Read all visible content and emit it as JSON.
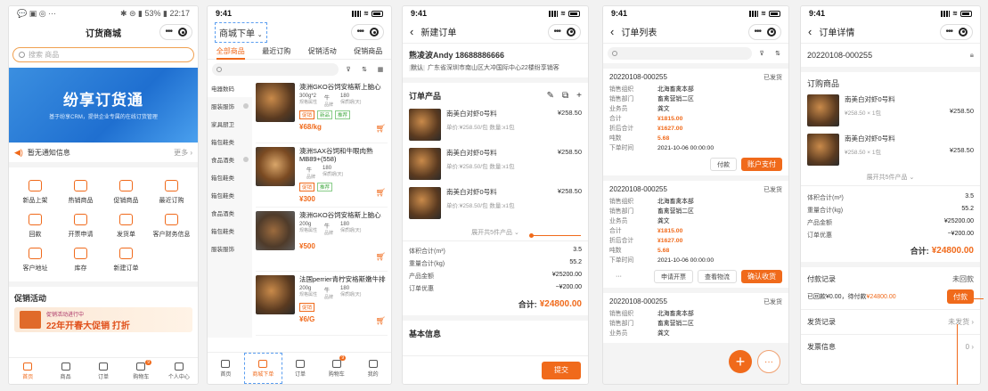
{
  "p1": {
    "status_left": "💬 ▣ ◎ ···",
    "status_right": "✱ ⊜ ▮ 53% ▮ 22:17",
    "title": "订货商城",
    "search_placeholder": "搜索 商品",
    "banner_title": "纷享订货通",
    "banner_sub": "基于纷享CRM，提供企业专属的在线订货管理",
    "notice_label": "暂无通知信息",
    "notice_more": "更多",
    "menu": [
      "新品上架",
      "热销商品",
      "促销商品",
      "最近订购",
      "回款",
      "开票申请",
      "发货单",
      "客户财务信息",
      "客户地址",
      "库存",
      "新建订单"
    ],
    "promo_title": "促销活动",
    "promo_line": "促销活动进行中",
    "promo_big": "22年开春大促销 打折",
    "tabs": [
      "首页",
      "商品",
      "订单",
      "购物车",
      "个人中心"
    ],
    "cart_badge": "9"
  },
  "p2": {
    "time": "9:41",
    "title": "商城下单",
    "tabs": [
      "全部商品",
      "最近订购",
      "促销活动",
      "促销商品"
    ],
    "cats": [
      "电器数码",
      "服装服饰",
      "家具厨卫",
      "箱包鞋类",
      "食品酒类",
      "箱包鞋类",
      "箱包鞋类",
      "食品酒类",
      "箱包鞋类",
      "服装服饰"
    ],
    "items": [
      {
        "name": "澳洲GKO谷饲安格斯上脑心",
        "spec": "300g*2",
        "unit_label": "规格属性",
        "v2": "牛",
        "v2l": "品牌",
        "v3": "180",
        "v3l": "保质期(天)",
        "tags": [
          "促销",
          "新品",
          "推荐"
        ],
        "price": "¥68/kg"
      },
      {
        "name": "澳洲SAX谷饲和牛眼肉熟MB89+(558)",
        "spec": "",
        "unit_label": "",
        "v2": "牛",
        "v2l": "品牌",
        "v3": "180",
        "v3l": "保质期(天)",
        "tags": [
          "促销",
          "推荐"
        ],
        "price": "¥300"
      },
      {
        "name": "澳洲GKO谷饲安格斯上脑心",
        "spec": "200g",
        "unit_label": "规格属性",
        "v2": "牛",
        "v2l": "品牌",
        "v3": "180",
        "v3l": "保质期(天)",
        "tags": [],
        "price": "¥500"
      },
      {
        "name": "法国perrier青柠安格斯嫩牛排",
        "spec": "200g",
        "unit_label": "规格属性",
        "v2": "牛",
        "v2l": "品牌",
        "v3": "180",
        "v3l": "保质期(天)",
        "tags": [
          "促销"
        ],
        "price": "¥6/G"
      }
    ],
    "tabs_bottom": [
      "首页",
      "商城下单",
      "订单",
      "购物车",
      "我的"
    ],
    "cart_badge": "9"
  },
  "p3": {
    "time": "9:41",
    "title": "新建订单",
    "contact": "熊凌波Andy  18688886666",
    "default_label": "默认",
    "address": "广东省深圳市南山区大冲国际中心22楼纷享销客",
    "section": "订单产品",
    "products": [
      {
        "name": "南美白对虾0号料",
        "price": "¥258.50",
        "sub": "单价:¥258.50/包  数量:x1包"
      },
      {
        "name": "南美白对虾0号料",
        "price": "¥258.50",
        "sub": "单价:¥258.50/包  数量:x1包"
      },
      {
        "name": "南美白对虾0号料",
        "price": "¥258.50",
        "sub": "单价:¥258.50/包  数量:x1包"
      }
    ],
    "expand": "展开共5件产品",
    "sums": [
      {
        "k": "体积合计(m³)",
        "v": "3.5"
      },
      {
        "k": "重量合计(kg)",
        "v": "55.2"
      },
      {
        "k": "产品金额",
        "v": "¥25200.00"
      },
      {
        "k": "订单优惠",
        "v": "−¥200.00"
      }
    ],
    "total_label": "合计:",
    "total": "¥24800.00",
    "basic": "基本信息",
    "submit": "提交"
  },
  "p4": {
    "time": "9:41",
    "title": "订单列表",
    "orders": [
      {
        "id": "20220108-000255",
        "status": "已发货",
        "rows": [
          {
            "k": "销售组织",
            "v": "北海畜禽本部"
          },
          {
            "k": "销售部门",
            "v": "畜禽营销二区"
          },
          {
            "k": "业务员",
            "v": "龚文"
          },
          {
            "k": "合计",
            "v": "¥1815.00"
          },
          {
            "k": "折后合计",
            "v": "¥1627.00"
          },
          {
            "k": "吨数",
            "v": "5.68"
          },
          {
            "k": "下单时间",
            "v": "2021-10-06 00:00:00"
          }
        ],
        "btns": [
          "付款",
          "账户支付"
        ]
      },
      {
        "id": "20220108-000255",
        "status": "已发货",
        "rows": [
          {
            "k": "销售组织",
            "v": "北海畜禽本部"
          },
          {
            "k": "销售部门",
            "v": "畜禽营销二区"
          },
          {
            "k": "业务员",
            "v": "龚文"
          },
          {
            "k": "合计",
            "v": "¥1815.00"
          },
          {
            "k": "折后合计",
            "v": "¥1627.00"
          },
          {
            "k": "吨数",
            "v": "5.68"
          },
          {
            "k": "下单时间",
            "v": "2021-10-06 00:00:00"
          }
        ],
        "btns": [
          "···",
          "申请开票",
          "查看物流",
          "确认收货"
        ]
      },
      {
        "id": "20220108-000255",
        "status": "已发货",
        "rows": [
          {
            "k": "销售组织",
            "v": "北海畜禽本部"
          },
          {
            "k": "销售部门",
            "v": "畜禽营销二区"
          },
          {
            "k": "业务员",
            "v": "龚文"
          }
        ],
        "btns": []
      }
    ],
    "fab_add": "+",
    "fab_more": "···"
  },
  "p5": {
    "time": "9:41",
    "title": "订单详情",
    "order_id": "20220108-000255",
    "section": "订购商品",
    "products": [
      {
        "name": "南美白对虾0号料",
        "sub": "¥258.50 × 1包",
        "price": "¥258.50"
      },
      {
        "name": "南美白对虾0号料",
        "sub": "¥258.50 × 1包",
        "price": "¥258.50"
      }
    ],
    "expand": "展开共5件产品",
    "sums": [
      {
        "k": "体积合计(m³)",
        "v": "3.5"
      },
      {
        "k": "重量合计(kg)",
        "v": "55.2"
      },
      {
        "k": "产品金额",
        "v": "¥25200.00"
      },
      {
        "k": "订单优惠",
        "v": "−¥200.00"
      }
    ],
    "total_label": "合计:",
    "total": "¥24800.00",
    "pay_title": "付款记录",
    "pay_status": "未回款",
    "pay_line": "已回款¥0.00，待付款",
    "pay_due": "¥24800.00",
    "pay_btn": "付款",
    "ship_title": "发货记录",
    "ship_status": "未发货",
    "invoice_title": "发票信息",
    "invoice_count": "0"
  },
  "colors": {
    "accent": "#f06a1b",
    "blue": "#1e88e5"
  }
}
